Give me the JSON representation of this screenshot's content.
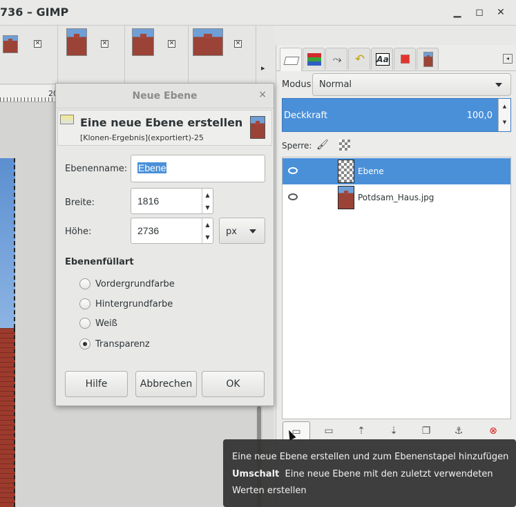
{
  "window": {
    "title": "736 – GIMP",
    "minimize_icon": "minimize-icon",
    "maximize_icon": "maximize-icon",
    "close_icon": "close-icon"
  },
  "image_tabs": {
    "close_glyph": "✕",
    "more_arrow": "▸"
  },
  "ruler": {
    "label": "20"
  },
  "dock": {
    "tabs": [
      "layers-icon",
      "channels-icon",
      "paths-icon",
      "undo-icon",
      "fonts-icon",
      "brush-icon",
      "images-icon"
    ],
    "fonts_tab_text": "Aa",
    "mode_label": "Modus:",
    "mode_value": "Normal",
    "opacity_label": "Deckkraft",
    "opacity_value": "100,0",
    "lock_label": "Sperre:",
    "layers": [
      {
        "name": "Ebene",
        "selected": true
      },
      {
        "name": "Potdsam_Haus.jpg",
        "selected": false
      }
    ],
    "buttons": [
      "new-layer-icon",
      "new-group-icon",
      "raise-layer-icon",
      "lower-layer-icon",
      "duplicate-layer-icon",
      "anchor-icon",
      "delete-layer-icon"
    ]
  },
  "dialog": {
    "title": "Neue Ebene",
    "close_glyph": "×",
    "header_title": "Eine neue Ebene erstellen",
    "header_subtitle": "[Klonen-Ergebnis](exportiert)-25",
    "name_label": "Ebenenname:",
    "name_value": "Ebene",
    "width_label": "Breite:",
    "width_value": "1816",
    "height_label": "Höhe:",
    "height_value": "2736",
    "unit_value": "px",
    "fill_heading": "Ebenenfüllart",
    "fill_options": [
      {
        "label": "Vordergrundfarbe",
        "checked": false
      },
      {
        "label": "Hintergrundfarbe",
        "checked": false
      },
      {
        "label": "Weiß",
        "checked": false
      },
      {
        "label": "Transparenz",
        "checked": true
      }
    ],
    "help_button": "Hilfe",
    "cancel_button": "Abbrechen",
    "ok_button": "OK"
  },
  "tooltip": {
    "line1": "Eine neue Ebene erstellen und zum Ebenenstapel hinzufügen",
    "modifier": "Umschalt",
    "line2_rest": "Eine neue Ebene mit den zuletzt verwendeten",
    "line3": "Werten erstellen"
  },
  "colors": {
    "selection": "#4a90d9",
    "tooltip_bg": "#353535"
  }
}
